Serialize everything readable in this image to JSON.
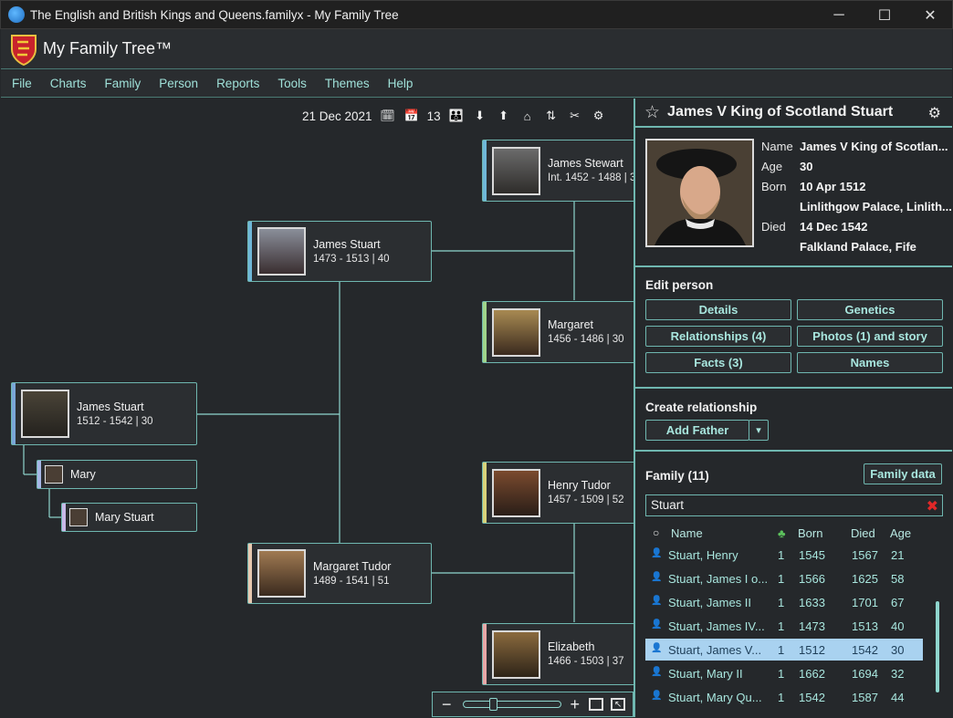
{
  "window": {
    "title": "The English and British Kings and Queens.familyx - My Family Tree",
    "controls": {
      "minimize": "─",
      "maximize": "☐",
      "close": "✕"
    }
  },
  "app": {
    "name": "My Family Tree™"
  },
  "menu": [
    "File",
    "Charts",
    "Family",
    "Person",
    "Reports",
    "Tools",
    "Themes",
    "Help"
  ],
  "toolbar": {
    "date": "21 Dec 2021",
    "count": "13"
  },
  "chart": {
    "people": [
      {
        "id": "james-stewart",
        "name": "James Stewart",
        "years": "Int. 1452 - 1488 | 3",
        "accent": "#6fb7d8"
      },
      {
        "id": "james-stuart-1473",
        "name": "James Stuart",
        "years": "1473 - 1513 | 40",
        "accent": "#6fb7d8"
      },
      {
        "id": "margaret",
        "name": "Margaret",
        "years": "1456 - 1486 | 30",
        "accent": "#9fd48a"
      },
      {
        "id": "james-stuart-1512",
        "name": "James Stuart",
        "years": "1512 - 1542 | 30",
        "accent": "#7aa6d8"
      },
      {
        "id": "henry-tudor",
        "name": "Henry Tudor",
        "years": "1457 - 1509 | 52",
        "accent": "#d8d27a"
      },
      {
        "id": "margaret-tudor",
        "name": "Margaret Tudor",
        "years": "1489 - 1541 | 51",
        "accent": "#e8c9b0"
      },
      {
        "id": "elizabeth",
        "name": "Elizabeth",
        "years": "1466 - 1503 | 37",
        "accent": "#e8a8a8"
      }
    ],
    "children": [
      {
        "name": "Mary",
        "accent": "#a8b8e8"
      },
      {
        "name": "Mary Stuart",
        "accent": "#c8b8e8"
      }
    ]
  },
  "panel": {
    "title": "James V King of Scotland Stuart",
    "details": [
      {
        "label": "Name",
        "value": "James V King of Scotlan..."
      },
      {
        "label": "Age",
        "value": "30"
      },
      {
        "label": "Born",
        "value": "10 Apr 1512"
      },
      {
        "label": "",
        "value": "Linlithgow Palace, Linlith..."
      },
      {
        "label": "Died",
        "value": "14 Dec 1542"
      },
      {
        "label": "",
        "value": "Falkland Palace, Fife"
      }
    ],
    "edit_title": "Edit person",
    "edit_buttons": [
      "Details",
      "Genetics",
      "Relationships (4)",
      "Photos (1) and story",
      "Facts (3)",
      "Names"
    ],
    "create_title": "Create relationship",
    "add_father": "Add Father",
    "family_title": "Family (11)",
    "family_data_button": "Family data",
    "search_value": "Stuart",
    "columns": [
      "Name",
      "Born",
      "Died",
      "Age"
    ],
    "rows": [
      {
        "name": "Stuart, Henry",
        "n": "1",
        "born": "1545",
        "died": "1567",
        "age": "21",
        "sex": "m"
      },
      {
        "name": "Stuart, James I o...",
        "n": "1",
        "born": "1566",
        "died": "1625",
        "age": "58",
        "sex": "m"
      },
      {
        "name": "Stuart, James II",
        "n": "1",
        "born": "1633",
        "died": "1701",
        "age": "67",
        "sex": "m"
      },
      {
        "name": "Stuart, James IV...",
        "n": "1",
        "born": "1473",
        "died": "1513",
        "age": "40",
        "sex": "m"
      },
      {
        "name": "Stuart, James V...",
        "n": "1",
        "born": "1512",
        "died": "1542",
        "age": "30",
        "sex": "m",
        "selected": true
      },
      {
        "name": "Stuart, Mary II",
        "n": "1",
        "born": "1662",
        "died": "1694",
        "age": "32",
        "sex": "f"
      },
      {
        "name": "Stuart, Mary Qu...",
        "n": "1",
        "born": "1542",
        "died": "1587",
        "age": "44",
        "sex": "f"
      }
    ]
  },
  "colors": {
    "accent": "#6fb7b0",
    "link": "#a8e6de",
    "selected_row": "#a9d2f0",
    "background": "#25282b"
  }
}
